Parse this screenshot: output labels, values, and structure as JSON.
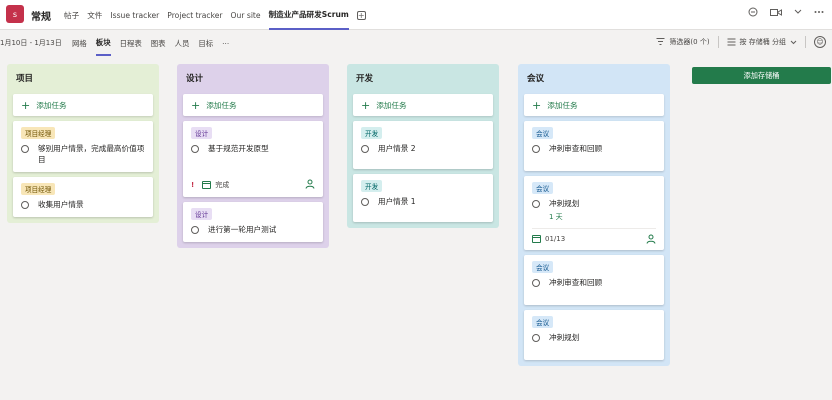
{
  "topbar": {
    "logo_text": "s",
    "team_name": "常规",
    "tabs": [
      "帖子",
      "文件",
      "Issue tracker",
      "Project tracker",
      "Our site",
      "制造业产品研发Scrum"
    ],
    "active_tab_index": 5,
    "add_tab_symbol": "+"
  },
  "subbar": {
    "date_range": "1月10日 - 1月13日",
    "views": [
      "网格",
      "板块",
      "日程表",
      "图表",
      "人员",
      "目标",
      "···"
    ],
    "active_view_index": 1,
    "filter_label": "筛选器(0 个)",
    "group_label": "按 存储桶 分组"
  },
  "board": {
    "add_task_label": "添加任务",
    "add_bucket_label": "添加存储桶",
    "columns": [
      {
        "title": "项目",
        "bg": "#e4efd6",
        "label_bg": "#f8e6b8",
        "label_fg": "#6d5100",
        "cards": [
          {
            "label": "项目经理",
            "title": "够别用户情景，完成最高价值项目"
          },
          {
            "label": "项目经理",
            "title": "收集用户情景"
          }
        ]
      },
      {
        "title": "设计",
        "bg": "#ddd1ea",
        "label_bg": "#e8def4",
        "label_fg": "#5c2e91",
        "cards": [
          {
            "label": "设计",
            "title": "基于规范开发原型",
            "footer": {
              "priority": "!",
              "status": "完成"
            }
          },
          {
            "label": "设计",
            "title": "进行第一轮用户测试"
          }
        ]
      },
      {
        "title": "开发",
        "bg": "#c9e6e3",
        "label_bg": "#d4eeee",
        "label_fg": "#006666",
        "cards": [
          {
            "label": "开发",
            "title": "用户情景 2"
          },
          {
            "label": "开发",
            "title": "用户情景 1"
          }
        ]
      },
      {
        "title": "会议",
        "bg": "#d2e5f6",
        "label_bg": "#d6e8f8",
        "label_fg": "#0f548c",
        "cards": [
          {
            "label": "会议",
            "title": "冲刺审查和回顾"
          },
          {
            "label": "会议",
            "title": "冲刺规划",
            "sub": "1 天",
            "footer": {
              "date": "01/13"
            }
          },
          {
            "label": "会议",
            "title": "冲刺审查和回顾"
          },
          {
            "label": "会议",
            "title": "冲刺规划"
          }
        ]
      }
    ]
  }
}
